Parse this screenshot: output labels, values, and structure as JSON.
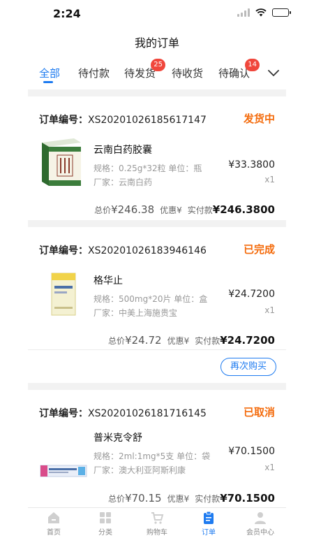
{
  "status_bar": {
    "time": "2:24"
  },
  "header": {
    "title": "我的订单"
  },
  "tabs": [
    {
      "label": "全部",
      "active": true
    },
    {
      "label": "待付款"
    },
    {
      "label": "待发货",
      "badge": "25"
    },
    {
      "label": "待收货"
    },
    {
      "label": "待确认",
      "badge": "14"
    }
  ],
  "orders": [
    {
      "order_no_label": "订单编号：",
      "order_no": "XS20201026185617147",
      "status": "发货中",
      "product": {
        "name": "云南白药胶囊",
        "spec": "规格：0.25g*32粒  单位：瓶",
        "maker": "厂家：云南白药",
        "price": "¥33.3800",
        "qty": "x1"
      },
      "total_label": "总价",
      "total": "¥246.38",
      "discount_label": "优惠",
      "discount": "¥",
      "paid_label": "实付款",
      "paid": "¥246.3800"
    },
    {
      "order_no_label": "订单编号：",
      "order_no": "XS20201026183946146",
      "status": "已完成",
      "product": {
        "name": "格华止",
        "spec": "规格：500mg*20片  单位：盒",
        "maker": "厂家：中美上海施贵宝",
        "price": "¥24.7200",
        "qty": "x1"
      },
      "total_label": "总价",
      "total": "¥24.72",
      "discount_label": "优惠",
      "discount": "¥",
      "paid_label": "实付款",
      "paid": "¥24.7200",
      "action": "再次购买"
    },
    {
      "order_no_label": "订单编号：",
      "order_no": "XS20201026181716145",
      "status": "已取消",
      "product": {
        "name": "普米克令舒",
        "spec": "规格：2ml:1mg*5支  单位：袋",
        "maker": "厂家：澳大利亚阿斯利康",
        "price": "¥70.1500",
        "qty": "x1"
      },
      "total_label": "总价",
      "total": "¥70.15",
      "discount_label": "优惠",
      "discount": "¥",
      "paid_label": "实付款",
      "paid": "¥70.1500"
    }
  ],
  "tabbar": [
    {
      "label": "首页",
      "icon": "home-icon"
    },
    {
      "label": "分类",
      "icon": "category-icon"
    },
    {
      "label": "购物车",
      "icon": "cart-icon"
    },
    {
      "label": "订单",
      "icon": "order-icon",
      "active": true
    },
    {
      "label": "会员中心",
      "icon": "member-icon"
    }
  ],
  "colors": {
    "accent": "#1e7bf0",
    "status": "#f46b0c",
    "badge": "#f0473c"
  }
}
